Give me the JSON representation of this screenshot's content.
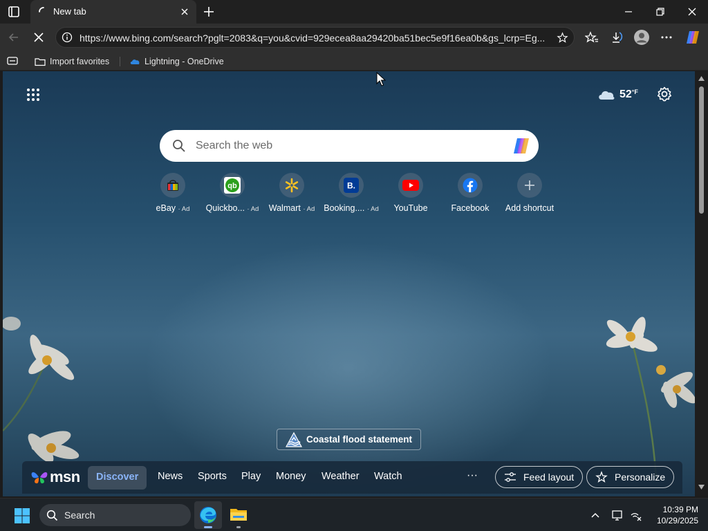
{
  "browser": {
    "tab_title": "New tab",
    "url": "https://www.bing.com/search?pglt=2083&q=you&cvid=929ecea8aa29420ba51bec5e9f16ea0b&gs_lcrp=Eg..."
  },
  "favorites": {
    "items": [
      {
        "label": "Import favorites",
        "icon": "folder-import-icon"
      },
      {
        "label": "Lightning - OneDrive",
        "icon": "onedrive-icon"
      }
    ]
  },
  "newtab": {
    "weather_temp": "52",
    "weather_unit": "°F",
    "search_placeholder": "Search the web",
    "shortcuts": [
      {
        "label": "eBay",
        "ad": "· Ad",
        "icon": "ebay-icon"
      },
      {
        "label": "Quickbo...",
        "ad": "· Ad",
        "icon": "quickbooks-icon"
      },
      {
        "label": "Walmart",
        "ad": "· Ad",
        "icon": "walmart-icon"
      },
      {
        "label": "Booking....",
        "ad": "· Ad",
        "icon": "booking-icon"
      },
      {
        "label": "YouTube",
        "ad": "",
        "icon": "youtube-icon"
      },
      {
        "label": "Facebook",
        "ad": "",
        "icon": "facebook-icon"
      },
      {
        "label": "Add shortcut",
        "ad": "",
        "icon": "plus-icon"
      }
    ],
    "alert": "Coastal flood statement"
  },
  "msn": {
    "logo_text": "msn",
    "tabs": [
      "Discover",
      "News",
      "Sports",
      "Play",
      "Money",
      "Weather",
      "Watch"
    ],
    "more": "···",
    "feed_layout": "Feed layout",
    "personalize": "Personalize"
  },
  "taskbar": {
    "search_label": "Search",
    "time": "10:39 PM",
    "date": "10/29/2025"
  },
  "colors": {
    "accent": "#8ab4f8",
    "page_top": "#1a3a56",
    "page_mid": "#3c6683",
    "taskbar": "#1e2328"
  }
}
